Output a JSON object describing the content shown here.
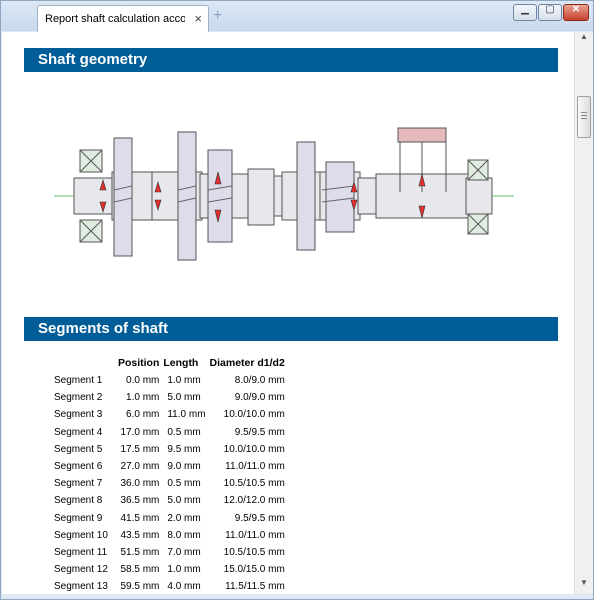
{
  "window": {
    "tab_title": "Report shaft calculation according",
    "tab_close": "×",
    "new_tab": "+",
    "minimize": "▁",
    "maximize": "▢",
    "close": "✕"
  },
  "sections": {
    "geometry_title": "Shaft geometry",
    "segments_title": "Segments of shaft"
  },
  "segments": {
    "columns": [
      "",
      "Position",
      "Length",
      "Diameter d1/d2"
    ],
    "rows": [
      {
        "name": "Segment 1",
        "position": "0.0 mm",
        "length": "1.0 mm",
        "diameter": "8.0/9.0 mm"
      },
      {
        "name": "Segment 2",
        "position": "1.0 mm",
        "length": "5.0 mm",
        "diameter": "9.0/9.0 mm"
      },
      {
        "name": "Segment 3",
        "position": "6.0 mm",
        "length": "11.0 mm",
        "diameter": "10.0/10.0 mm"
      },
      {
        "name": "Segment 4",
        "position": "17.0 mm",
        "length": "0.5 mm",
        "diameter": "9.5/9.5 mm"
      },
      {
        "name": "Segment 5",
        "position": "17.5 mm",
        "length": "9.5 mm",
        "diameter": "10.0/10.0 mm"
      },
      {
        "name": "Segment 6",
        "position": "27.0 mm",
        "length": "9.0 mm",
        "diameter": "11.0/11.0 mm"
      },
      {
        "name": "Segment 7",
        "position": "36.0 mm",
        "length": "0.5 mm",
        "diameter": "10.5/10.5 mm"
      },
      {
        "name": "Segment 8",
        "position": "36.5 mm",
        "length": "5.0 mm",
        "diameter": "12.0/12.0 mm"
      },
      {
        "name": "Segment 9",
        "position": "41.5 mm",
        "length": "2.0 mm",
        "diameter": "9.5/9.5 mm"
      },
      {
        "name": "Segment 10",
        "position": "43.5 mm",
        "length": "8.0 mm",
        "diameter": "11.0/11.0 mm"
      },
      {
        "name": "Segment 11",
        "position": "51.5 mm",
        "length": "7.0 mm",
        "diameter": "10.5/10.5 mm"
      },
      {
        "name": "Segment 12",
        "position": "58.5 mm",
        "length": "1.0 mm",
        "diameter": "15.0/15.0 mm"
      },
      {
        "name": "Segment 13",
        "position": "59.5 mm",
        "length": "4.0 mm",
        "diameter": "11.5/11.5 mm"
      }
    ]
  },
  "colors": {
    "header_bg": "#005d98",
    "gear_fill": "#dcdcea",
    "bearing_fill": "#e0ece0",
    "load_fill": "#e6b9bd",
    "axis_line": "#3cb43c",
    "force_arrow": "#e03030"
  },
  "icons": {
    "tab_close": "close-icon",
    "new_tab": "plus-icon",
    "minimize": "minimize-icon",
    "maximize": "maximize-icon",
    "close": "close-icon",
    "scroll_up": "arrow-up-icon",
    "scroll_down": "arrow-down-icon"
  }
}
